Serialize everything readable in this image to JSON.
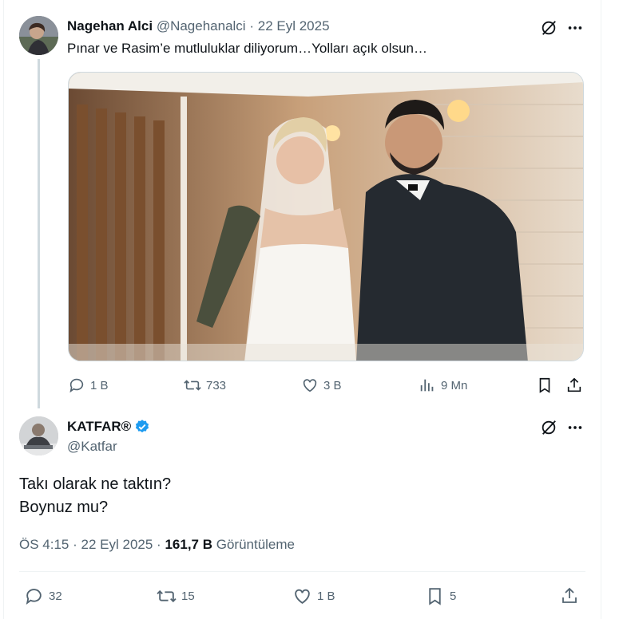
{
  "parent": {
    "name": "Nagehan Alci",
    "handle": "@Nagehanalci",
    "separator": "·",
    "date": "22 Eyl 2025",
    "text": "Pınar ve Rasim’e mutluluklar diliyorum…Yolları açık olsun…",
    "stats": {
      "replies": "1 B",
      "reposts": "733",
      "likes": "3 B",
      "views": "9 Mn"
    }
  },
  "reply": {
    "name": "KATFAR®",
    "handle": "@Katfar",
    "lines": [
      "Takı olarak ne taktın?",
      "Boynuz mu?"
    ],
    "time": "ÖS 4:15",
    "date": "22 Eyl 2025",
    "views_count": "161,7 B",
    "views_label": "Görüntüleme",
    "stats": {
      "replies": "32",
      "reposts": "15",
      "likes": "1 B",
      "bookmarks": "5"
    }
  },
  "colors": {
    "muted": "#536471",
    "text": "#0f1419",
    "verified": "#1d9bf0",
    "divider": "#eff3f4"
  },
  "icons": [
    "grok-icon",
    "more-icon",
    "reply-icon",
    "repost-icon",
    "like-icon",
    "views-icon",
    "bookmark-icon",
    "share-icon",
    "verified-badge-icon"
  ]
}
